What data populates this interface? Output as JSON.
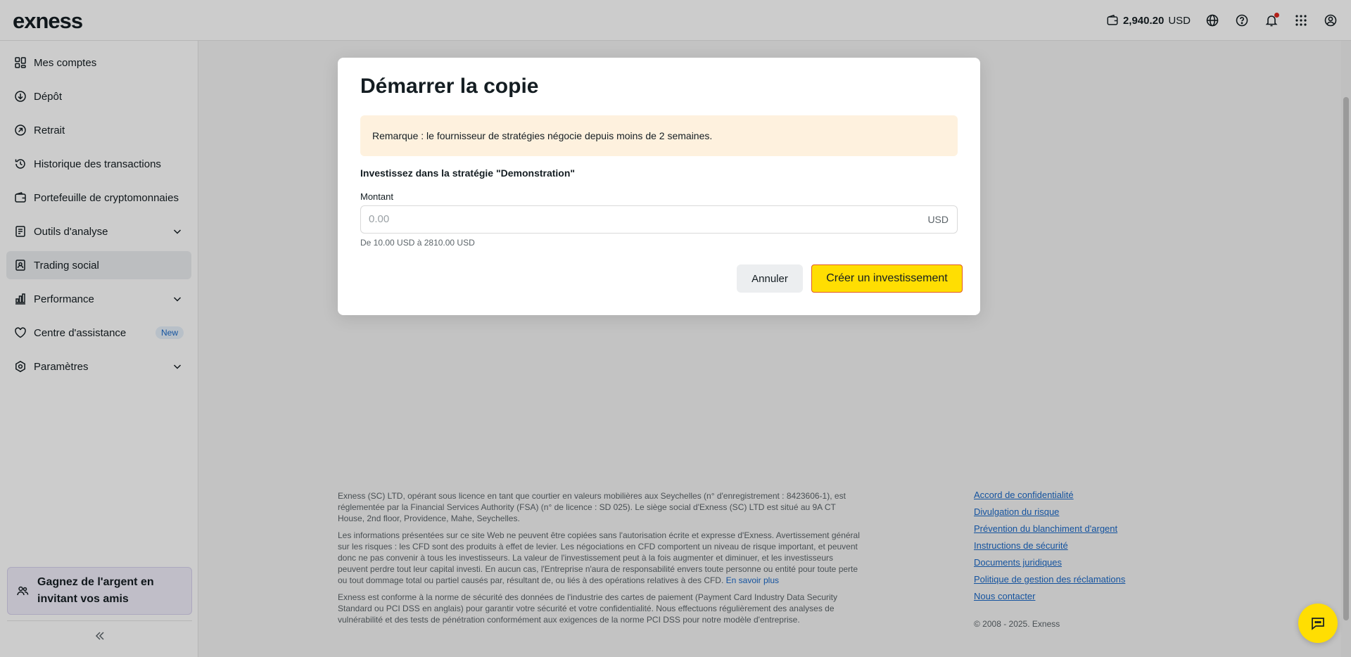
{
  "header": {
    "logo": "exness",
    "balance_amount": "2,940.20",
    "balance_currency": "USD"
  },
  "sidebar": {
    "items": [
      {
        "label": "Mes comptes",
        "icon": "grid-icon"
      },
      {
        "label": "Dépôt",
        "icon": "arrow-down-circle-icon"
      },
      {
        "label": "Retrait",
        "icon": "arrow-up-right-circle-icon"
      },
      {
        "label": "Historique des transactions",
        "icon": "history-icon"
      },
      {
        "label": "Portefeuille de cryptomonnaies",
        "icon": "wallet-icon"
      },
      {
        "label": "Outils d'analyse",
        "icon": "analysis-icon"
      },
      {
        "label": "Trading social",
        "icon": "social-trading-icon"
      },
      {
        "label": "Performance",
        "icon": "bar-chart-icon"
      },
      {
        "label": "Centre d'assistance",
        "icon": "heart-icon",
        "badge": "New"
      },
      {
        "label": "Paramètres",
        "icon": "settings-icon"
      }
    ],
    "invite_label": "Gagnez de l'argent en invitant vos amis"
  },
  "modal": {
    "title": "Démarrer la copie",
    "notice": "Remarque : le fournisseur de stratégies négocie depuis moins de 2 semaines.",
    "strategy_label": "Investissez dans la stratégie \"Demonstration\"",
    "amount_label": "Montant",
    "amount_placeholder": "0.00",
    "amount_value": "",
    "amount_currency": "USD",
    "amount_hint": "De 10.00 USD à 2810.00 USD",
    "cancel_label": "Annuler",
    "create_label": "Créer un investissement"
  },
  "footer": {
    "legal_1": "Exness (SC) LTD, opérant sous licence en tant que courtier en valeurs mobilières aux Seychelles (n° d'enregistrement : 8423606-1), est réglementée par la Financial Services Authority (FSA) (n° de licence : SD 025). Le siège social d'Exness (SC) LTD est situé au 9A CT House, 2nd floor, Providence, Mahe, Seychelles.",
    "legal_2": "Les informations présentées sur ce site Web ne peuvent être copiées sans l'autorisation écrite et expresse d'Exness. Avertissement général sur les risques : les CFD sont des produits à effet de levier. Les négociations en CFD comportent un niveau de risque important, et peuvent donc ne pas convenir à tous les investisseurs. La valeur de l'investissement peut à la fois augmenter et diminuer, et les investisseurs peuvent perdre tout leur capital investi. En aucun cas, l'Entreprise n'aura de responsabilité envers toute personne ou entité pour toute perte ou tout dommage total ou partiel causés par, résultant de, ou liés à des opérations relatives à des CFD.",
    "learn_more": "En savoir plus",
    "legal_3": "Exness est conforme à la norme de sécurité des données de l'industrie des cartes de paiement (Payment Card Industry Data Security Standard ou PCI DSS en anglais) pour garantir votre sécurité et votre confidentialité. Nous effectuons régulièrement des analyses de vulnérabilité et des tests de pénétration conformément aux exigences de la norme PCI DSS pour notre modèle d'entreprise.",
    "links": [
      "Accord de confidentialité",
      "Divulgation du risque",
      "Prévention du blanchiment d'argent",
      "Instructions de sécurité",
      "Documents juridiques",
      "Politique de gestion des réclamations",
      "Nous contacter"
    ],
    "copyright": "© 2008 - 2025. Exness"
  }
}
